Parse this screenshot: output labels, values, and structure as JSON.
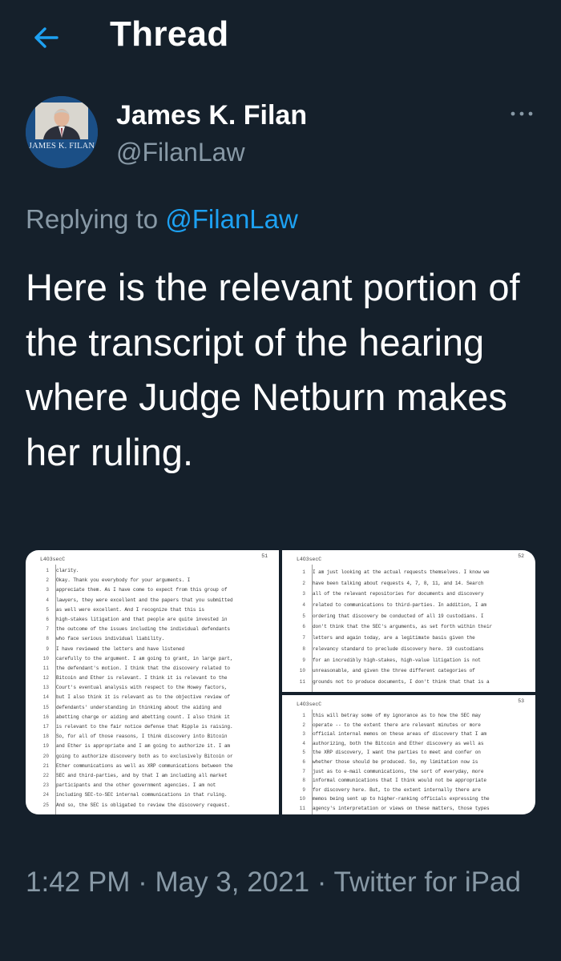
{
  "header": {
    "title": "Thread",
    "back_icon": "arrow-left-icon"
  },
  "colors": {
    "background": "#15202b",
    "accent": "#1da1f2",
    "muted": "#8899a6"
  },
  "tweet": {
    "author_name": "James K. Filan",
    "author_handle": "@FilanLaw",
    "avatar_text": "JAMES K. FILAN",
    "replying_prefix": "Replying to ",
    "replying_handle": "@FilanLaw",
    "text": "Here is the relevant portion of the transcript of the hearing where Judge Netburn makes her ruling.",
    "timestamp": "1:42 PM · May 3, 2021 · Twitter for iPad"
  },
  "media": {
    "pages": [
      {
        "case_id": "L4O3secC",
        "page_number": "51",
        "lines": [
          {
            "n": "1",
            "t": "clarity."
          },
          {
            "n": "2",
            "t": "         Okay.  Thank you everybody for your arguments.  I"
          },
          {
            "n": "3",
            "t": "appreciate them.  As I have come to expect from this group of"
          },
          {
            "n": "4",
            "t": "lawyers, they were excellent and the papers that you submitted"
          },
          {
            "n": "5",
            "t": "as well were excellent.  And I recognize that this is"
          },
          {
            "n": "6",
            "t": "high-stakes litigation and that people are quite invested in"
          },
          {
            "n": "7",
            "t": "the outcome of the issues including the individual defendants"
          },
          {
            "n": "8",
            "t": "who face serious individual liability."
          },
          {
            "n": "9",
            "t": "         I have reviewed the letters and have listened"
          },
          {
            "n": "10",
            "t": "carefully to the argument.  I am going to grant, in large part,"
          },
          {
            "n": "11",
            "t": "the defendant's motion.  I think that the discovery related to"
          },
          {
            "n": "12",
            "t": "Bitcoin and Ether is relevant.  I think it is relevant to the"
          },
          {
            "n": "13",
            "t": "Court's eventual analysis with respect to the Howey factors,"
          },
          {
            "n": "14",
            "t": "but I also think it is relevant as to the objective review of"
          },
          {
            "n": "15",
            "t": "defendants' understanding in thinking about the aiding and"
          },
          {
            "n": "16",
            "t": "abetting charge or aiding and abetting count.  I also think it"
          },
          {
            "n": "17",
            "t": "is relevant to the fair notice defense that Ripple is raising."
          },
          {
            "n": "18",
            "t": "So, for all of those reasons, I think discovery into Bitcoin"
          },
          {
            "n": "19",
            "t": "and Ether is appropriate and I am going to authorize it.  I am"
          },
          {
            "n": "20",
            "t": "going to authorize discovery both as to exclusively Bitcoin or"
          },
          {
            "n": "21",
            "t": "Ether communications as well as XRP communications between the"
          },
          {
            "n": "22",
            "t": "SEC and third-parties, and by that I am including all market"
          },
          {
            "n": "23",
            "t": "participants and the other government agencies.  I am not"
          },
          {
            "n": "24",
            "t": "including SEC-to-SEC internal communications in that ruling."
          },
          {
            "n": "25",
            "t": "And so, the SEC is obligated to review the discovery request."
          }
        ]
      },
      {
        "case_id": "L4O3secC",
        "page_number": "52",
        "lines": [
          {
            "n": "1",
            "t": "I am just looking at the actual requests themselves.  I know we"
          },
          {
            "n": "2",
            "t": "have been talking about requests 4, 7, 8, 11, and 14.  Search"
          },
          {
            "n": "3",
            "t": "all of the relevant repositories for documents and discovery"
          },
          {
            "n": "4",
            "t": "related to communications to third-parties.  In addition, I am"
          },
          {
            "n": "5",
            "t": "ordering that discovery be conducted of all 19 custodians.  I"
          },
          {
            "n": "6",
            "t": "don't think that the SEC's arguments, as set forth within their"
          },
          {
            "n": "7",
            "t": "letters and again today, are a legitimate basis given the"
          },
          {
            "n": "8",
            "t": "relevancy standard to preclude discovery here.  19 custodians"
          },
          {
            "n": "9",
            "t": "for an incredibly high-stakes, high-value litigation is not"
          },
          {
            "n": "10",
            "t": "unreasonable, and given the three different categories of"
          },
          {
            "n": "11",
            "t": "grounds not to produce documents, I don't think that that is a"
          }
        ]
      },
      {
        "case_id": "L4O3secC",
        "page_number": "53",
        "lines": [
          {
            "n": "1",
            "t": "this will betray some of my ignorance as to how the SEC may"
          },
          {
            "n": "2",
            "t": "operate -- to the extent there are relevant minutes or more"
          },
          {
            "n": "3",
            "t": "official internal memos on these areas of discovery that I am"
          },
          {
            "n": "4",
            "t": "authorizing, both the Bitcoin and Ether discovery as well as"
          },
          {
            "n": "5",
            "t": "the XRP discovery, I want the parties to meet and confer on"
          },
          {
            "n": "6",
            "t": "whether those should be produced.  So, my limitation now is"
          },
          {
            "n": "7",
            "t": "just as to e-mail communications, the sort of everyday, more"
          },
          {
            "n": "8",
            "t": "informal communications that I think would not be appropriate"
          },
          {
            "n": "9",
            "t": "for discovery here.  But, to the extent internally there are"
          },
          {
            "n": "10",
            "t": "memos being sent up to higher-ranking officials expressing the"
          },
          {
            "n": "11",
            "t": "agency's interpretation or views on these matters, those types"
          }
        ]
      }
    ]
  }
}
